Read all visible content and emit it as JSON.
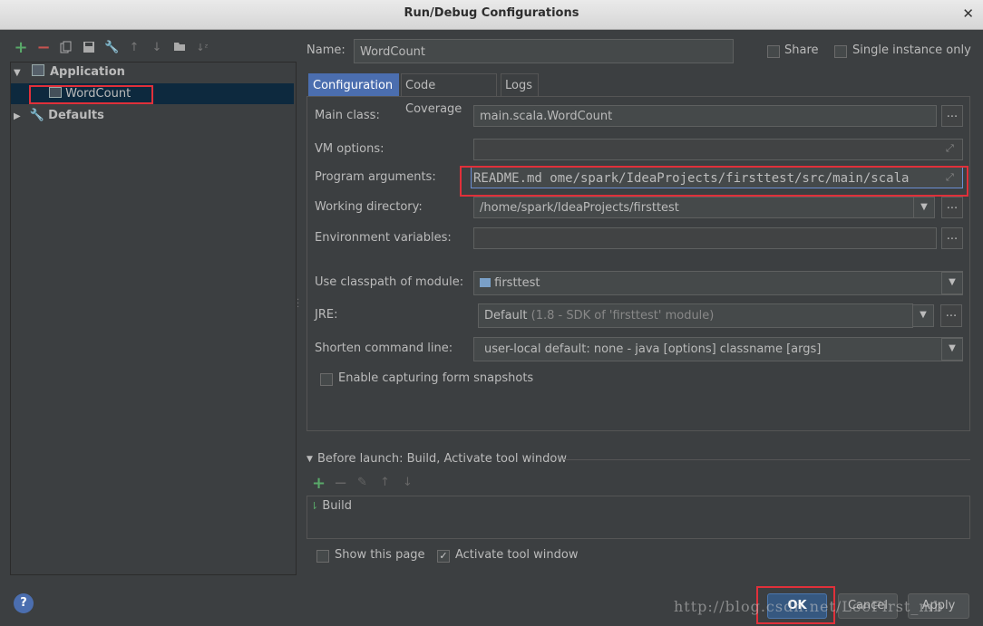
{
  "window": {
    "title": "Run/Debug Configurations"
  },
  "toolbar": {
    "icons": [
      "add-icon",
      "remove-icon",
      "copy-icon",
      "save-icon",
      "wrench-icon",
      "arrow-up-icon",
      "arrow-down-icon",
      "folder-icon",
      "sort-icon"
    ]
  },
  "tree": {
    "application": "Application",
    "wordcount": "WordCount",
    "defaults": "Defaults"
  },
  "header": {
    "name_label": "Name:",
    "name_value": "WordCount",
    "share_label": "Share",
    "single_instance_label": "Single instance only"
  },
  "tabs": [
    "Configuration",
    "Code Coverage",
    "Logs"
  ],
  "config": {
    "main_class_label": "Main class:",
    "main_class_value": "main.scala.WordCount",
    "vm_options_label": "VM options:",
    "vm_options_value": "",
    "program_args_label": "Program arguments:",
    "program_args_value": "README.md ome/spark/IdeaProjects/firsttest/src/main/scala",
    "working_dir_label": "Working directory:",
    "working_dir_value": "/home/spark/IdeaProjects/firsttest",
    "env_vars_label": "Environment variables:",
    "env_vars_value": "",
    "classpath_label": "Use classpath of module:",
    "classpath_value": "firsttest",
    "jre_label": "JRE:",
    "jre_value": "Default",
    "jre_detail": "(1.8 - SDK of 'firsttest' module)",
    "shorten_label": "Shorten command line:",
    "shorten_value": "user-local default: none - java [options] classname [args]",
    "snapshots_label": "Enable capturing form snapshots",
    "ellipsis": "..."
  },
  "before_launch": {
    "title": "Before launch: Build, Activate tool window",
    "item": "Build"
  },
  "footer": {
    "show_page_label": "Show this page",
    "activate_label": "Activate tool window",
    "ok": "OK",
    "cancel": "Cancel",
    "apply": "Apply",
    "watermark": "http://blog.csdn.net/LeeFirst_mb"
  }
}
